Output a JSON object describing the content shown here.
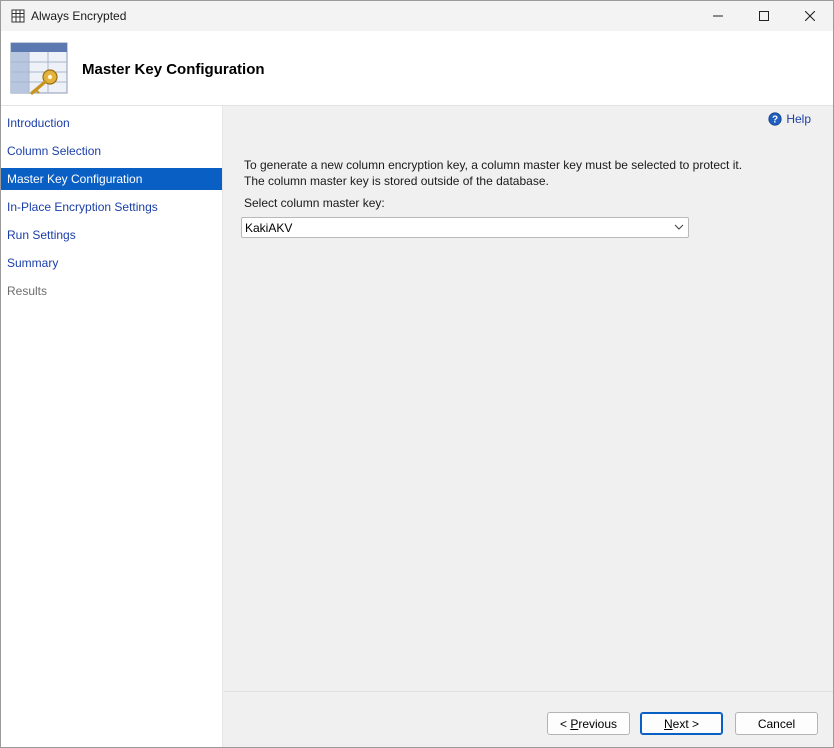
{
  "window": {
    "title": "Always Encrypted"
  },
  "header": {
    "title": "Master Key Configuration"
  },
  "sidebar": {
    "items": [
      {
        "label": "Introduction",
        "state": "link"
      },
      {
        "label": "Column Selection",
        "state": "link"
      },
      {
        "label": "Master Key Configuration",
        "state": "selected"
      },
      {
        "label": "In-Place Encryption Settings",
        "state": "link"
      },
      {
        "label": "Run Settings",
        "state": "link"
      },
      {
        "label": "Summary",
        "state": "link"
      },
      {
        "label": "Results",
        "state": "disabled"
      }
    ]
  },
  "main": {
    "help_label": "Help",
    "description": "To generate a new column encryption key, a column master key must be selected to protect it.  The column master key is stored outside of the database.",
    "select_label": "Select column master key:",
    "select_value": "KakiAKV"
  },
  "footer": {
    "previous": {
      "prefix": "< ",
      "mnemonic": "P",
      "rest": "revious"
    },
    "next": {
      "mnemonic": "N",
      "rest": "ext >"
    },
    "cancel": "Cancel"
  },
  "colors": {
    "accent": "#0a5fc4",
    "link": "#1a3ea8",
    "disabled": "#6d6d6d",
    "panel": "#f0f0f0"
  },
  "icons": {
    "app": "table-grid-icon",
    "header": "table-key-icon",
    "help": "help-circle-icon",
    "dropdown": "chevron-down-icon"
  }
}
